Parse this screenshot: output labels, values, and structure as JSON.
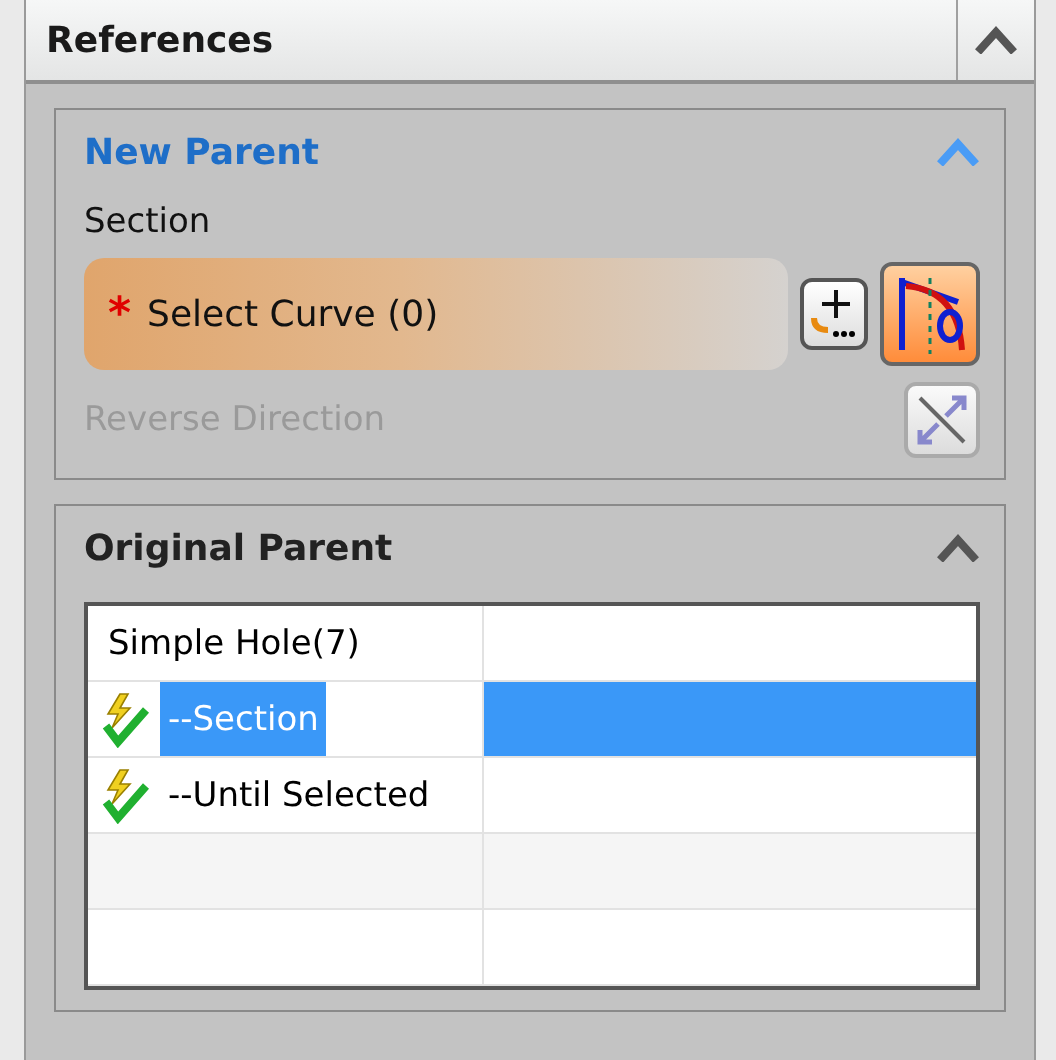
{
  "panel": {
    "title": "References",
    "expanded": true
  },
  "new_parent": {
    "title": "New Parent",
    "expanded": true,
    "section_label": "Section",
    "select_curve": {
      "label": "Select Curve (0)",
      "required_marker": "*"
    },
    "reverse_direction": {
      "label": "Reverse Direction",
      "disabled": true
    }
  },
  "original_parent": {
    "title": "Original Parent",
    "expanded": true,
    "rows": [
      {
        "text": "Simple Hole(7)",
        "kind": "feature",
        "selected": false
      },
      {
        "text": "--Section",
        "kind": "parameter",
        "selected": true
      },
      {
        "text": "--Until Selected",
        "kind": "parameter",
        "selected": false
      }
    ]
  }
}
